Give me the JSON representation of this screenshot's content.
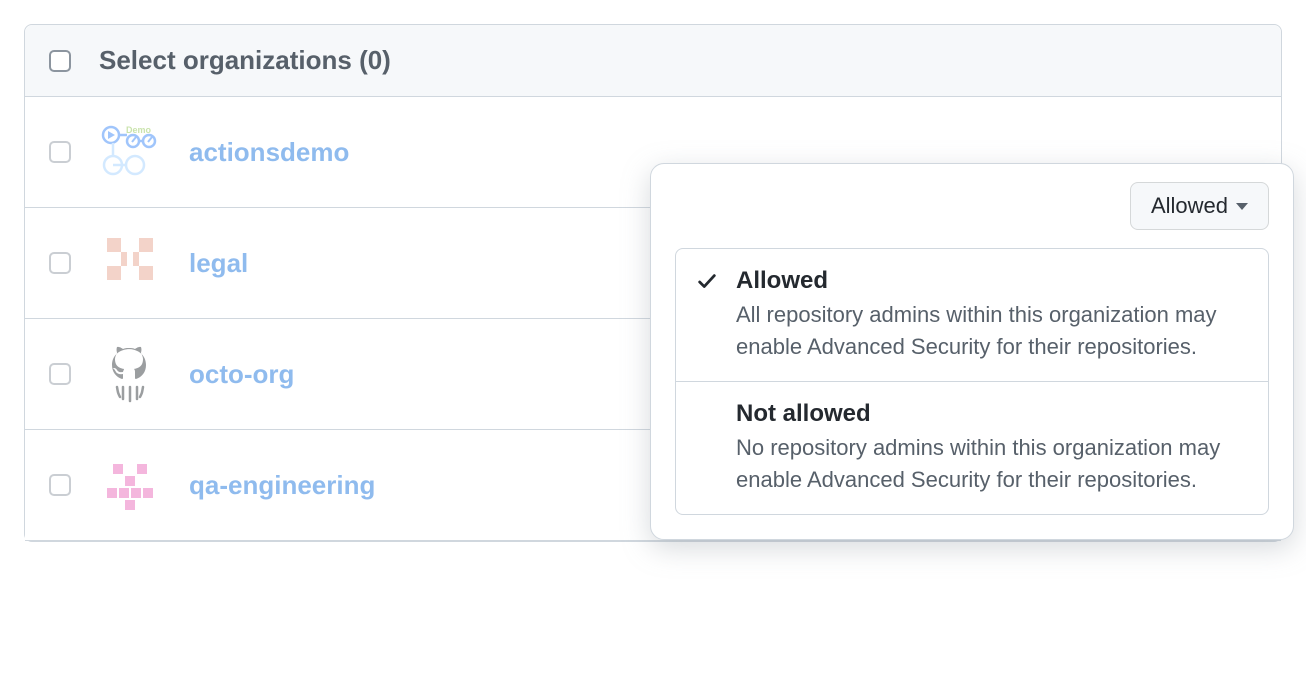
{
  "header": {
    "title": "Select organizations (0)"
  },
  "buttons": {
    "allowed": "Allowed"
  },
  "orgs": [
    {
      "name": "actionsdemo"
    },
    {
      "name": "legal"
    },
    {
      "name": "octo-org"
    },
    {
      "name": "qa-engineering"
    }
  ],
  "dropdown": {
    "options": [
      {
        "title": "Allowed",
        "description": "All repository admins within this organization may enable Advanced Security for their repositories.",
        "selected": true
      },
      {
        "title": "Not allowed",
        "description": "No repository admins within this organization may enable Advanced Security for their repositories.",
        "selected": false
      }
    ]
  }
}
